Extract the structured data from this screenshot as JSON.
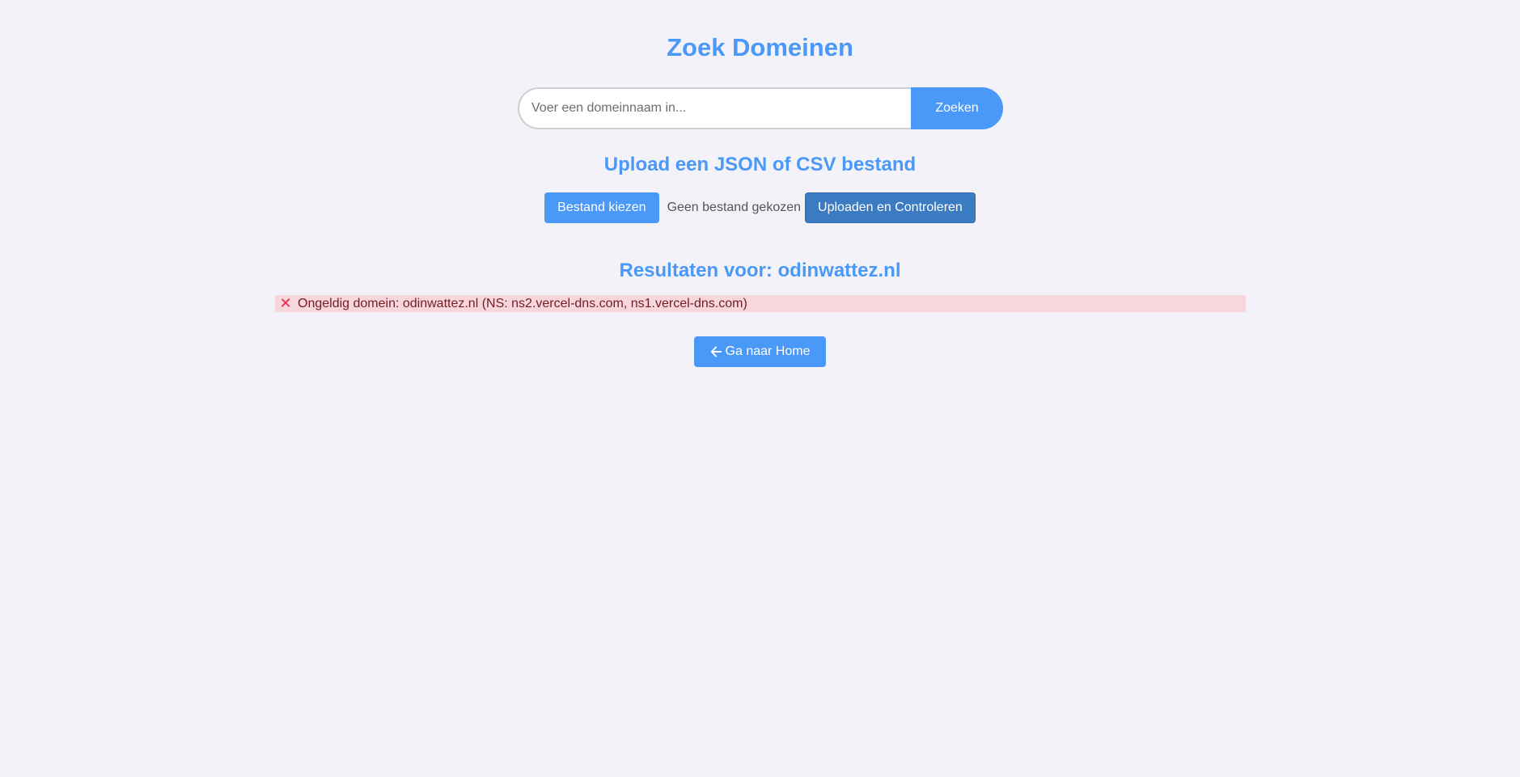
{
  "header": {
    "title": "Zoek Domeinen"
  },
  "search": {
    "placeholder": "Voer een domeinnaam in...",
    "value": "",
    "button_label": "Zoeken"
  },
  "upload": {
    "title": "Upload een JSON of CSV bestand",
    "choose_label": "Bestand kiezen",
    "no_file_label": "Geen bestand gekozen",
    "submit_label": "Uploaden en Controleren"
  },
  "results": {
    "title": "Resultaten voor: odinwattez.nl",
    "items": [
      {
        "status": "invalid",
        "icon": "cross-icon",
        "text": "Ongeldig domein: odinwattez.nl (NS: ns2.vercel-dns.com, ns1.vercel-dns.com)"
      }
    ]
  },
  "home": {
    "label": "Ga naar Home",
    "icon": "arrow-left-icon"
  },
  "colors": {
    "accent": "#4a98f7",
    "upload_button": "#3a7bc2",
    "background": "#f3f2f8",
    "error_background": "#f7d7dc",
    "error_text": "#721c24",
    "error_icon": "#e8264a"
  }
}
